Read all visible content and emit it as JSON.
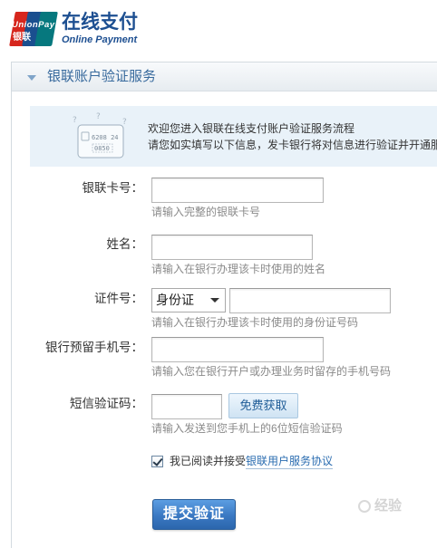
{
  "brand": {
    "logo_text_en": "UnionPay",
    "logo_text_cn": "银联",
    "title_cn": "在线支付",
    "title_en": "Online Payment"
  },
  "panel": {
    "title": "银联账户验证服务"
  },
  "notice": {
    "line1": "欢迎您进入银联在线支付账户验证服务流程",
    "line2": "请您如实填写以下信息，发卡银行将对信息进行验证并开通服",
    "illustration": {
      "mark": "?",
      "card_number": "6208 24",
      "card_code": "0850"
    }
  },
  "form": {
    "card_number": {
      "label": "银联卡号：",
      "value": "",
      "hint": "请输入完整的银联卡号"
    },
    "name": {
      "label": "姓名：",
      "value": "",
      "hint": "请输入在银行办理该卡时使用的姓名"
    },
    "id_number": {
      "label": "证件号：",
      "id_type": "身份证",
      "value": "",
      "hint": "请输入在银行办理该卡时使用的身份证号码"
    },
    "phone": {
      "label": "银行预留手机号：",
      "value": "",
      "hint": "请输入您在银行开户或办理业务时留存的手机号码"
    },
    "sms_code": {
      "label": "短信验证码：",
      "value": "",
      "button": "免费获取",
      "hint": "请输入发送到您手机上的6位短信验证码"
    },
    "agreement": {
      "checked": true,
      "text": "我已阅读并接受",
      "link": "银联用户服务协议"
    },
    "submit": "提交验证"
  },
  "watermark": "经验",
  "icons": {
    "panel_toggle": "triangle-down-icon",
    "select_caret": "caret-down-icon",
    "checkbox": "checkmark-icon",
    "notice_art": "bank-card-icon"
  },
  "colors": {
    "logo_red": "#d6261d",
    "logo_blue": "#1a4f8f",
    "logo_teal": "#06787e",
    "brand": "#1d4f91",
    "link": "#2a6cb0",
    "notice_bg": "#e9f2f9",
    "submit": "#3a78c2"
  }
}
